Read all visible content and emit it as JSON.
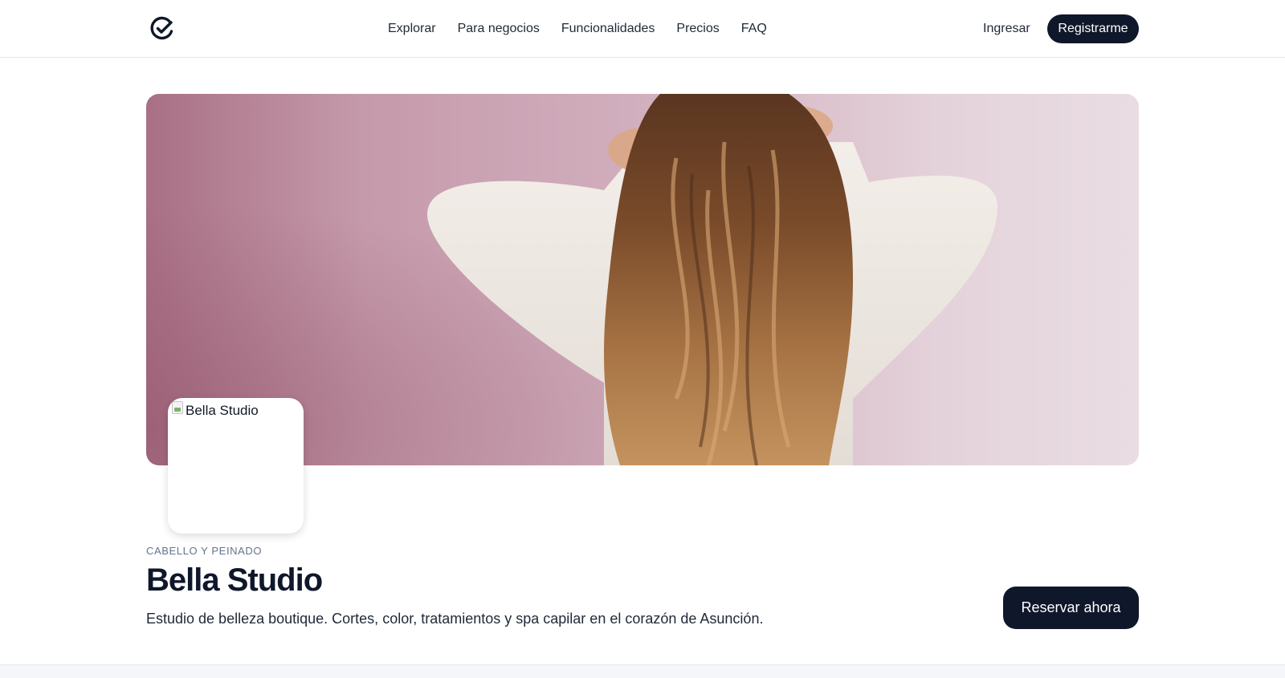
{
  "header": {
    "logo": "check-circle-logo",
    "nav": [
      {
        "label": "Explorar"
      },
      {
        "label": "Para negocios"
      },
      {
        "label": "Funcionalidades"
      },
      {
        "label": "Precios"
      },
      {
        "label": "FAQ"
      }
    ],
    "login_label": "Ingresar",
    "signup_label": "Registrarme"
  },
  "hero": {
    "image": "woman-with-long-wavy-hair-pink-background"
  },
  "business": {
    "avatar_alt": "Bella Studio",
    "category": "CABELLO Y PEINADO",
    "name": "Bella Studio",
    "description": "Estudio de belleza boutique. Cortes, color, tratamientos y spa capilar en el corazón de Asunción.",
    "book_label": "Reservar ahora"
  },
  "colors": {
    "primary": "#0f172a",
    "hero_bg": "#d4b3c1"
  }
}
